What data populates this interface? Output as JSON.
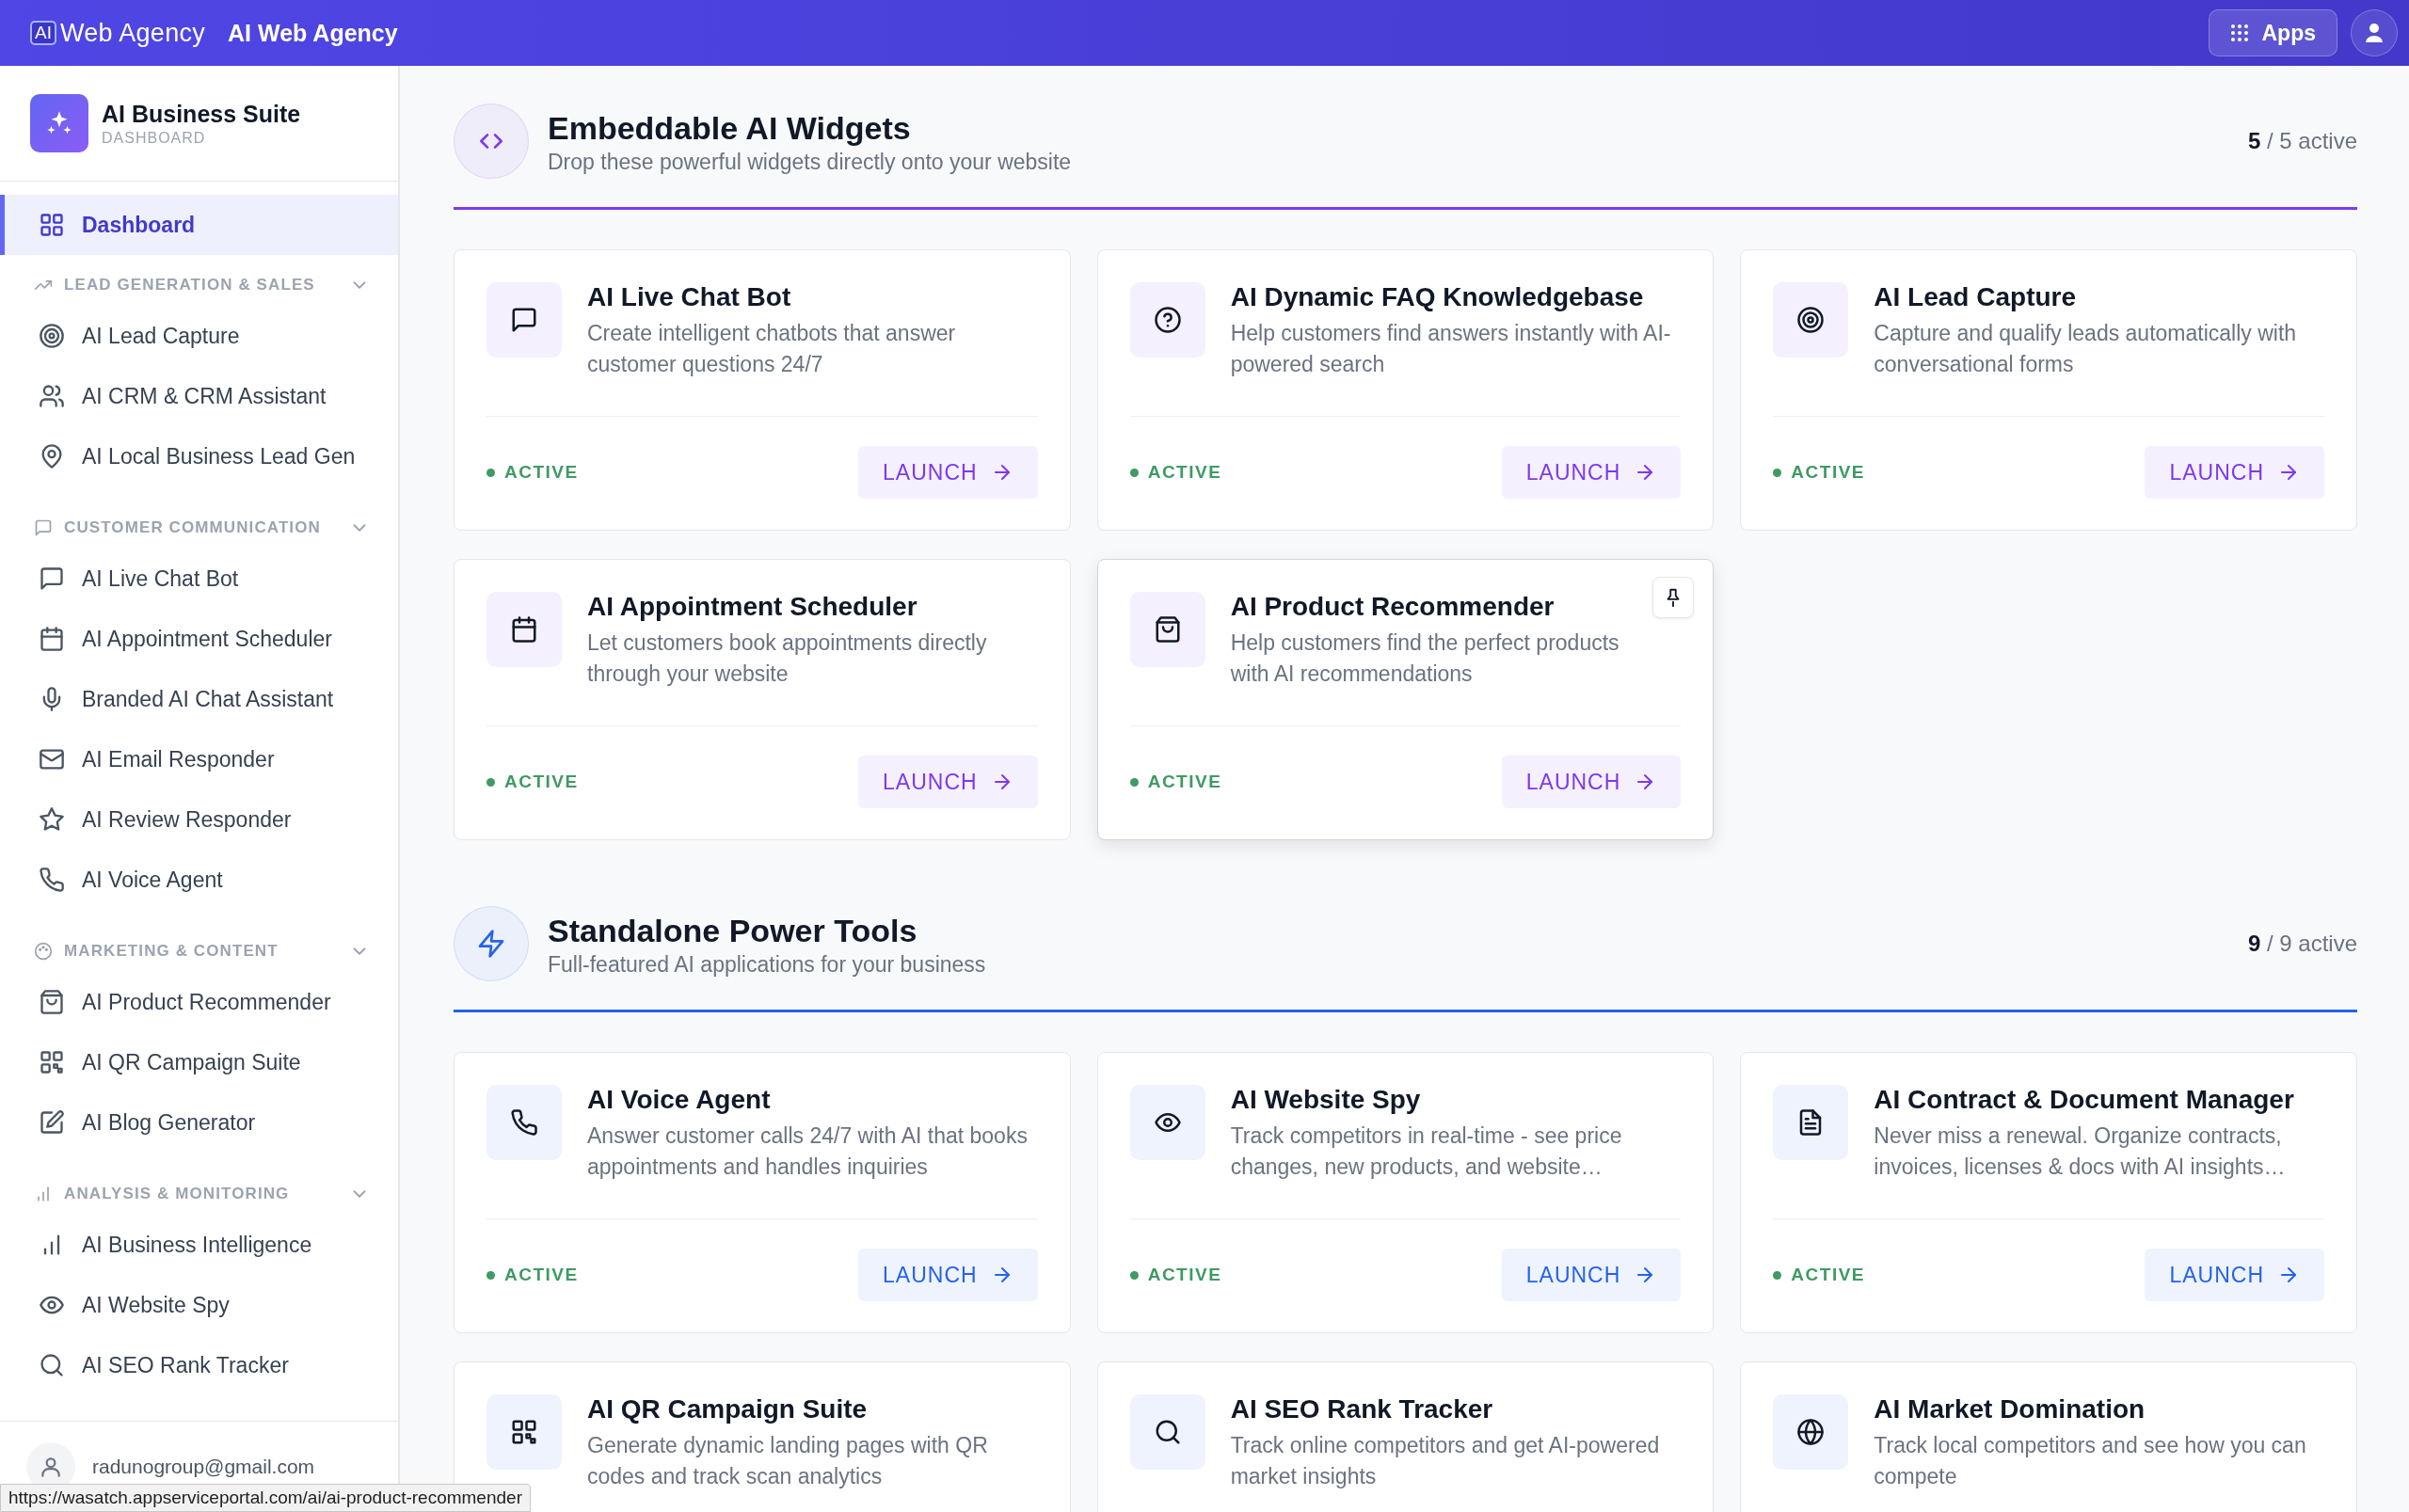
{
  "topbar": {
    "logo_mark": "AI",
    "logo_text": "Web Agency",
    "title": "AI Web Agency",
    "apps_button": "Apps"
  },
  "sidebar": {
    "title": "AI Business Suite",
    "subtitle": "DASHBOARD",
    "dashboard": {
      "label": "Dashboard",
      "selected": true
    },
    "groups": [
      {
        "label": "LEAD GENERATION & SALES",
        "expanded": true,
        "items": [
          {
            "label": "AI Lead Capture",
            "selected": false
          },
          {
            "label": "AI CRM & CRM Assistant",
            "selected": false
          },
          {
            "label": "AI Local Business Lead Gen",
            "selected": false
          }
        ]
      },
      {
        "label": "CUSTOMER COMMUNICATION",
        "expanded": true,
        "items": [
          {
            "label": "AI Live Chat Bot",
            "selected": false
          },
          {
            "label": "AI Appointment Scheduler",
            "selected": false
          },
          {
            "label": "Branded AI Chat Assistant",
            "selected": false
          },
          {
            "label": "AI Email Responder",
            "selected": false
          },
          {
            "label": "AI Review Responder",
            "selected": false
          },
          {
            "label": "AI Voice Agent",
            "selected": false
          }
        ]
      },
      {
        "label": "MARKETING & CONTENT",
        "expanded": true,
        "items": [
          {
            "label": "AI Product Recommender",
            "selected": false
          },
          {
            "label": "AI QR Campaign Suite",
            "selected": false
          },
          {
            "label": "AI Blog Generator",
            "selected": false
          }
        ]
      },
      {
        "label": "ANALYSIS & MONITORING",
        "expanded": true,
        "items": [
          {
            "label": "AI Business Intelligence",
            "selected": false
          },
          {
            "label": "AI Website Spy",
            "selected": false
          },
          {
            "label": "AI SEO Rank Tracker",
            "selected": false
          }
        ]
      }
    ],
    "user_email": "radunogroup@gmail.com"
  },
  "sections": [
    {
      "title": "Embeddable AI Widgets",
      "subtitle": "Drop these powerful widgets directly onto your website",
      "count": "**5** / 5 active",
      "color": "#7c3aed",
      "cards": [
        {
          "title": "AI Live Chat Bot",
          "description": "Create intelligent chatbots that answer customer questions 24/7",
          "status": "ACTIVE",
          "button": "LAUNCH",
          "hovered": false
        },
        {
          "title": "AI Dynamic FAQ Knowledgebase",
          "description": "Help customers find answers instantly with AI-powered search",
          "status": "ACTIVE",
          "button": "LAUNCH",
          "hovered": false
        },
        {
          "title": "AI Lead Capture",
          "description": "Capture and qualify leads automatically with conversational forms",
          "status": "ACTIVE",
          "button": "LAUNCH",
          "hovered": false
        },
        {
          "title": "AI Appointment Scheduler",
          "description": "Let customers book appointments directly through your website",
          "status": "ACTIVE",
          "button": "LAUNCH",
          "hovered": false
        },
        {
          "title": "AI Product Recommender",
          "description": "Help customers find the perfect products with AI recommendations",
          "status": "ACTIVE",
          "button": "LAUNCH",
          "hovered": true
        }
      ]
    },
    {
      "title": "Standalone Power Tools",
      "subtitle": "Full-featured AI applications for your business",
      "count": "**9** / 9 active",
      "color": "#2563eb",
      "cards": [
        {
          "title": "AI Voice Agent",
          "description": "Answer customer calls 24/7 with AI that books appointments and handles inquiries",
          "status": "ACTIVE",
          "button": "LAUNCH",
          "hovered": false
        },
        {
          "title": "AI Website Spy",
          "description": "Track competitors in real-time - see price changes, new products, and website…",
          "status": "ACTIVE",
          "button": "LAUNCH",
          "hovered": false
        },
        {
          "title": "AI Contract & Document Manager",
          "description": "Never miss a renewal. Organize contracts, invoices, licenses & docs with AI insights…",
          "status": "ACTIVE",
          "button": "LAUNCH",
          "hovered": false
        },
        {
          "title": "AI QR Campaign Suite",
          "description": "Generate dynamic landing pages with QR codes and track scan analytics",
          "hovered": false
        },
        {
          "title": "AI SEO Rank Tracker",
          "description": "Track online competitors and get AI-powered market insights",
          "hovered": false
        },
        {
          "title": "AI Market Domination",
          "description": "Track local competitors and see how you can compete",
          "hovered": false
        }
      ]
    }
  ],
  "status_url": "https://wasatch.appserviceportal.com/ai/ai-product-recommender"
}
